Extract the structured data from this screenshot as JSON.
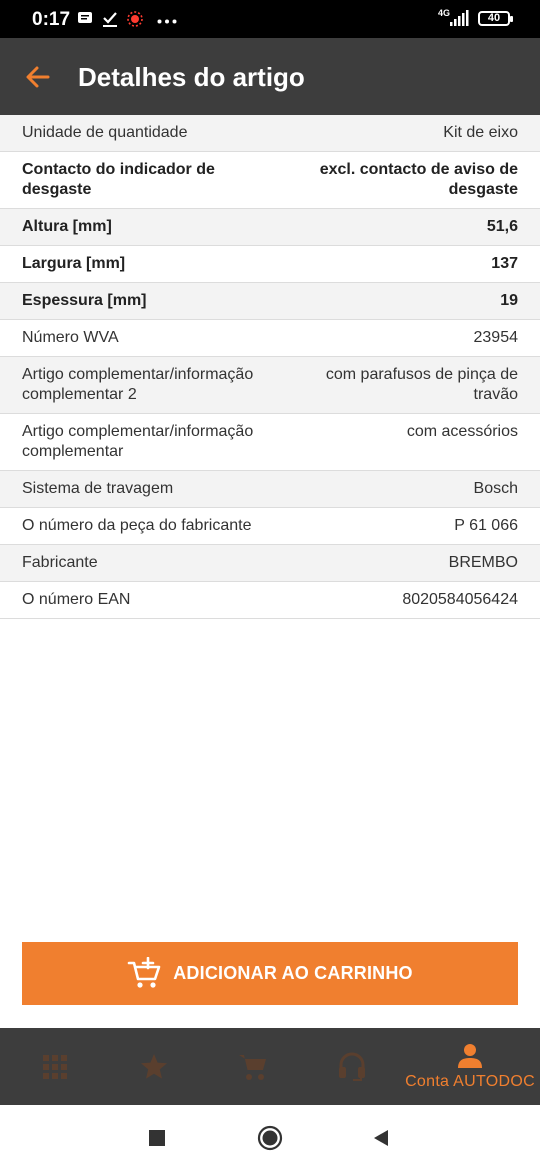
{
  "status_bar": {
    "time": "0:17",
    "network": "4G",
    "battery": "40"
  },
  "app_bar": {
    "title": "Detalhes do artigo"
  },
  "details": [
    {
      "label": "Unidade de quantidade",
      "value": "Kit de eixo"
    },
    {
      "label": "Contacto do indicador de desgaste",
      "value": "excl. contacto de aviso de desgaste"
    },
    {
      "label": "Altura [mm]",
      "value": "51,6"
    },
    {
      "label": "Largura [mm]",
      "value": "137"
    },
    {
      "label": "Espessura [mm]",
      "value": "19"
    },
    {
      "label": "Número WVA",
      "value": "23954"
    },
    {
      "label": "Artigo complementar/informação complementar 2",
      "value": "com parafusos de pinça de travão"
    },
    {
      "label": "Artigo complementar/informação complementar",
      "value": "com acessórios"
    },
    {
      "label": "Sistema de travagem",
      "value": "Bosch"
    },
    {
      "label": "O número da peça do fabricante",
      "value": "P 61 066"
    },
    {
      "label": "Fabricante",
      "value": "BREMBO"
    },
    {
      "label": "O número EAN",
      "value": "8020584056424"
    }
  ],
  "actions": {
    "add_to_cart": "ADICIONAR AO CARRINHO"
  },
  "bottom_nav": {
    "items": [
      {
        "icon": "grid-icon",
        "label": ""
      },
      {
        "icon": "star-icon",
        "label": ""
      },
      {
        "icon": "cart-icon",
        "label": ""
      },
      {
        "icon": "headset-icon",
        "label": ""
      },
      {
        "icon": "person-icon",
        "label": "Conta AUTODOC"
      }
    ],
    "active_index": 4
  },
  "colors": {
    "accent": "#f07f2f",
    "bar": "#3d3d3d",
    "inactive_icon": "#5a3f2e",
    "row_shade": "#f3f3f3"
  }
}
